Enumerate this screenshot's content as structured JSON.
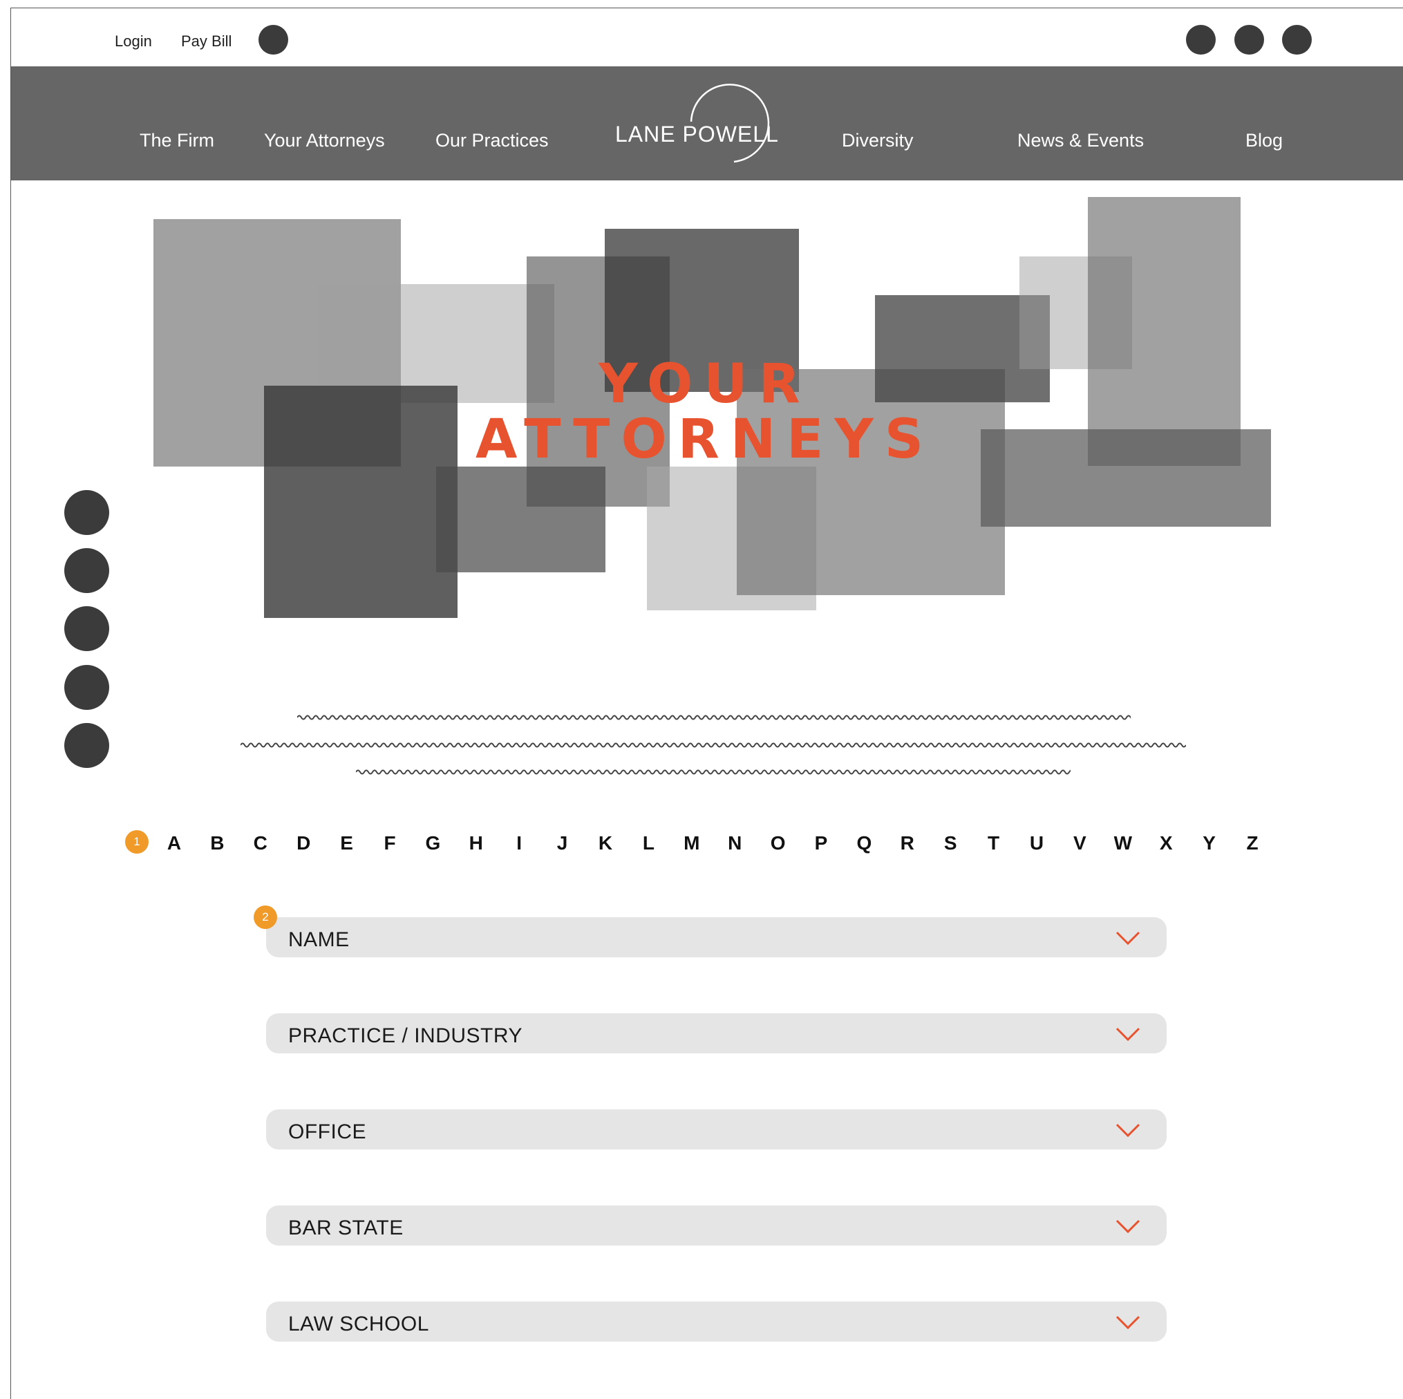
{
  "utility": {
    "login": "Login",
    "pay_bill": "Pay Bill",
    "icons": [
      "search-icon",
      "social-icon",
      "social-icon",
      "social-icon"
    ]
  },
  "nav": {
    "items": [
      "The Firm",
      "Your Attorneys",
      "Our Practices",
      "Diversity",
      "News & Events",
      "Blog"
    ],
    "logo": "LANE POWELL"
  },
  "hero": {
    "title_line1": "YOUR",
    "title_line2": "ATTORNEYS"
  },
  "alphabet": {
    "badge": "1",
    "letters": [
      "A",
      "B",
      "C",
      "D",
      "E",
      "F",
      "G",
      "H",
      "I",
      "J",
      "K",
      "L",
      "M",
      "N",
      "O",
      "P",
      "Q",
      "R",
      "S",
      "T",
      "U",
      "V",
      "W",
      "X",
      "Y",
      "Z"
    ]
  },
  "filters": {
    "badge": "2",
    "items": [
      "NAME",
      "PRACTICE / INDUSTRY",
      "OFFICE",
      "BAR STATE",
      "LAW SCHOOL"
    ]
  },
  "colors": {
    "accent": "#e8532f",
    "badge": "#f09a2a",
    "nav_bg": "#666666",
    "dropdown_bg": "#e5e5e5"
  }
}
